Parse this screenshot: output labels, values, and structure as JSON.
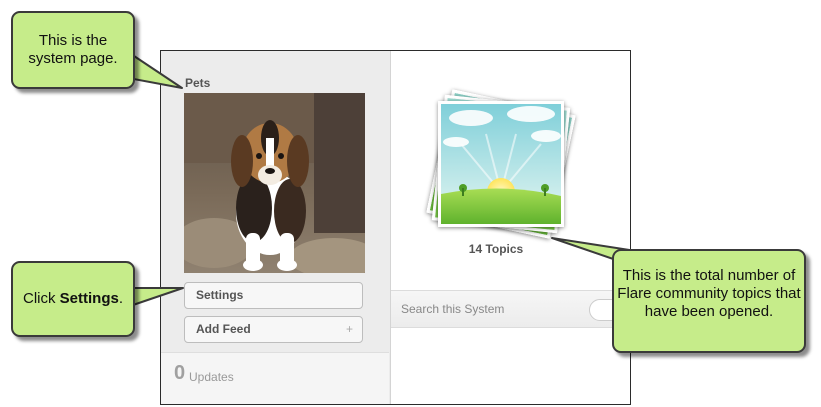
{
  "system": {
    "name": "Pets",
    "buttons": {
      "settings": "Settings",
      "add_feed": "Add Feed",
      "add_feed_icon": "+"
    },
    "updates": {
      "count": "0",
      "label": "Updates"
    }
  },
  "topics": {
    "count_label": "14 Topics",
    "search_label": "Search this System"
  },
  "callouts": {
    "system_page": "This is the system page.",
    "click_prefix": "Click ",
    "click_target": "Settings",
    "click_suffix": ".",
    "topics_info": "This is the total number of Flare community topics that have been opened."
  },
  "colors": {
    "callout_fill": "#c6ec8a",
    "callout_border": "#3a3a3a",
    "sidebar_bg": "#ececec"
  }
}
